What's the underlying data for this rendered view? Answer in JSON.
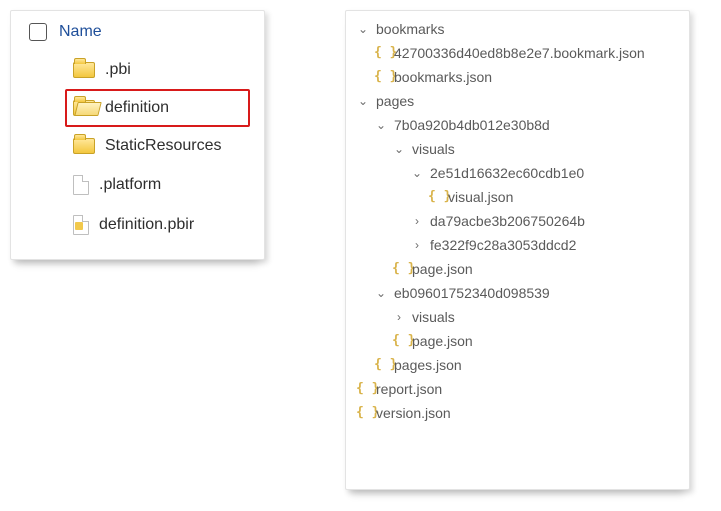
{
  "file_panel": {
    "header": {
      "name": "Name"
    },
    "rows": [
      {
        "label": ".pbi",
        "icon": "folder",
        "highlight": false
      },
      {
        "label": "definition",
        "icon": "folder-open",
        "highlight": true
      },
      {
        "label": "StaticResources",
        "icon": "folder",
        "highlight": false
      },
      {
        "label": ".platform",
        "icon": "page",
        "highlight": false
      },
      {
        "label": "definition.pbir",
        "icon": "page-pbir",
        "highlight": false
      }
    ]
  },
  "tree": [
    {
      "indent": 0,
      "kind": "folder",
      "state": "expanded",
      "label": "bookmarks"
    },
    {
      "indent": 1,
      "kind": "json",
      "state": "",
      "label": "42700336d40ed8b8e2e7.bookmark.json"
    },
    {
      "indent": 1,
      "kind": "json",
      "state": "",
      "label": "bookmarks.json"
    },
    {
      "indent": 0,
      "kind": "folder",
      "state": "expanded",
      "label": "pages"
    },
    {
      "indent": 1,
      "kind": "folder",
      "state": "expanded",
      "label": "7b0a920b4db012e30b8d"
    },
    {
      "indent": 2,
      "kind": "folder",
      "state": "expanded",
      "label": "visuals"
    },
    {
      "indent": 3,
      "kind": "folder",
      "state": "expanded",
      "label": "2e51d16632ec60cdb1e0"
    },
    {
      "indent": 4,
      "kind": "json",
      "state": "",
      "label": "visual.json"
    },
    {
      "indent": 3,
      "kind": "folder",
      "state": "collapsed",
      "label": "da79acbe3b206750264b"
    },
    {
      "indent": 3,
      "kind": "folder",
      "state": "collapsed",
      "label": "fe322f9c28a3053ddcd2"
    },
    {
      "indent": 2,
      "kind": "json",
      "state": "",
      "label": "page.json"
    },
    {
      "indent": 1,
      "kind": "folder",
      "state": "expanded",
      "label": "eb09601752340d098539"
    },
    {
      "indent": 2,
      "kind": "folder",
      "state": "collapsed",
      "label": "visuals"
    },
    {
      "indent": 2,
      "kind": "json",
      "state": "",
      "label": "page.json"
    },
    {
      "indent": 1,
      "kind": "json",
      "state": "",
      "label": "pages.json"
    },
    {
      "indent": 0,
      "kind": "json",
      "state": "",
      "label": "report.json"
    },
    {
      "indent": 0,
      "kind": "json",
      "state": "",
      "label": "version.json"
    }
  ]
}
